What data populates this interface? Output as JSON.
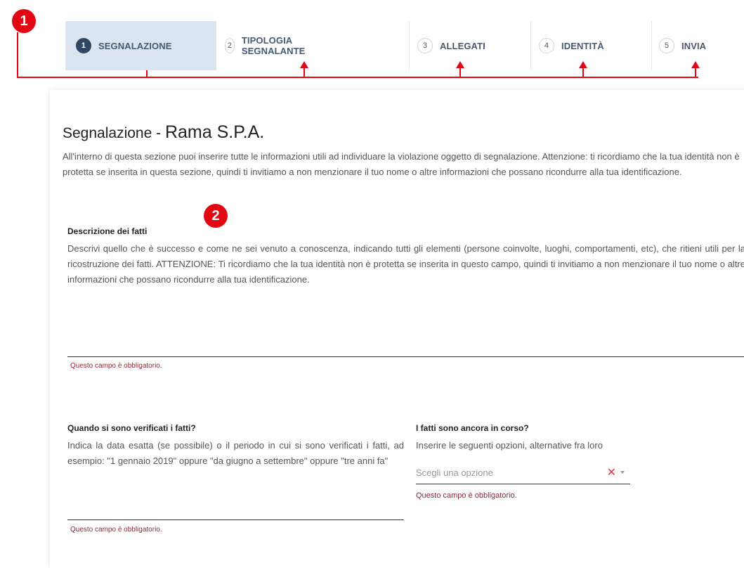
{
  "annotations": {
    "badge_1": "1",
    "badge_2": "2",
    "color": "#e30613"
  },
  "stepper": {
    "steps": [
      {
        "num": "1",
        "label": "SEGNALAZIONE",
        "active": true
      },
      {
        "num": "2",
        "label": "TIPOLOGIA SEGNALANTE",
        "active": false
      },
      {
        "num": "3",
        "label": "ALLEGATI",
        "active": false
      },
      {
        "num": "4",
        "label": "IDENTITÀ",
        "active": false
      },
      {
        "num": "5",
        "label": "INVIA",
        "active": false
      }
    ]
  },
  "section": {
    "title_prefix": "Segnalazione - ",
    "company": "Rama S.P.A.",
    "intro": "All'interno di questa sezione puoi inserire tutte le informazioni utili ad individuare la violazione oggetto di segnalazione. Attenzione: ti ricordiamo che la tua identità non è protetta se inserita in questa sezione, quindi ti invitiamo a non menzionare il tuo nome o altre informazioni che possano ricondurre alla tua identificazione."
  },
  "fields": {
    "descrizione": {
      "label": "Descrizione dei fatti",
      "description": "Descrivi quello che è successo e come ne sei venuto a conoscenza, indicando tutti gli elementi (persone coinvolte, luoghi, comportamenti, etc), che ritieni utili per la ricostruzione dei fatti. ATTENZIONE: Ti ricordiamo che la tua identità non è protetta se inserita in questo campo, quindi ti invitiamo a non menzionare il tuo nome o altre informazioni che possano ricondurre alla tua identificazione.",
      "value": "",
      "error": "Questo campo è obbligatorio."
    },
    "quando": {
      "label": "Quando si sono verificati i fatti?",
      "description": "Indica la data esatta (se possibile) o il periodo in cui si sono verificati i fatti, ad esempio: \"1 gennaio 2019\" oppure \"da giugno a settembre\" oppure \"tre anni fa\"",
      "value": "",
      "error": "Questo campo è obbligatorio."
    },
    "in_corso": {
      "label": "I fatti sono ancora in corso?",
      "description": "Inserire le seguenti opzioni, alternative fra loro",
      "placeholder": "Scegli una opzione",
      "clear_glyph": "✕",
      "error": "Questo campo è obbligatorio."
    }
  },
  "colors": {
    "active_step_bg": "#dbe5f1",
    "step_text": "#455a73",
    "error_text": "#8b2a38"
  }
}
